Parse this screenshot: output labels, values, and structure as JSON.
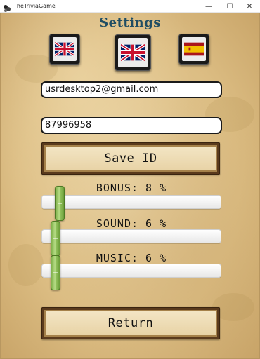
{
  "window": {
    "title": "TheTriviaGame",
    "minimize_symbol": "—",
    "maximize_symbol": "☐",
    "close_symbol": "✕"
  },
  "settings": {
    "title": "Settings"
  },
  "languages": [
    {
      "name": "english-flag-small",
      "icon": "uk-flag-icon"
    },
    {
      "name": "english-flag-selected",
      "icon": "uk-flag-icon"
    },
    {
      "name": "spanish-flag",
      "icon": "spain-flag-icon"
    }
  ],
  "account": {
    "email": "usrdesktop2@gmail.com",
    "user_id": "87996958",
    "save_label": "Save ID"
  },
  "sliders": {
    "bonus": {
      "label": "BONUS: 8 %",
      "value_percent": 8
    },
    "sound": {
      "label": "SOUND: 6 %",
      "value_percent": 6
    },
    "music": {
      "label": "MUSIC: 6 %",
      "value_percent": 6
    }
  },
  "footer": {
    "return_label": "Return"
  },
  "colors": {
    "title": "#1f4d63",
    "parchment": "#dcbd83",
    "thumb": "#8fc05a",
    "wood": "#5a3a1c"
  }
}
